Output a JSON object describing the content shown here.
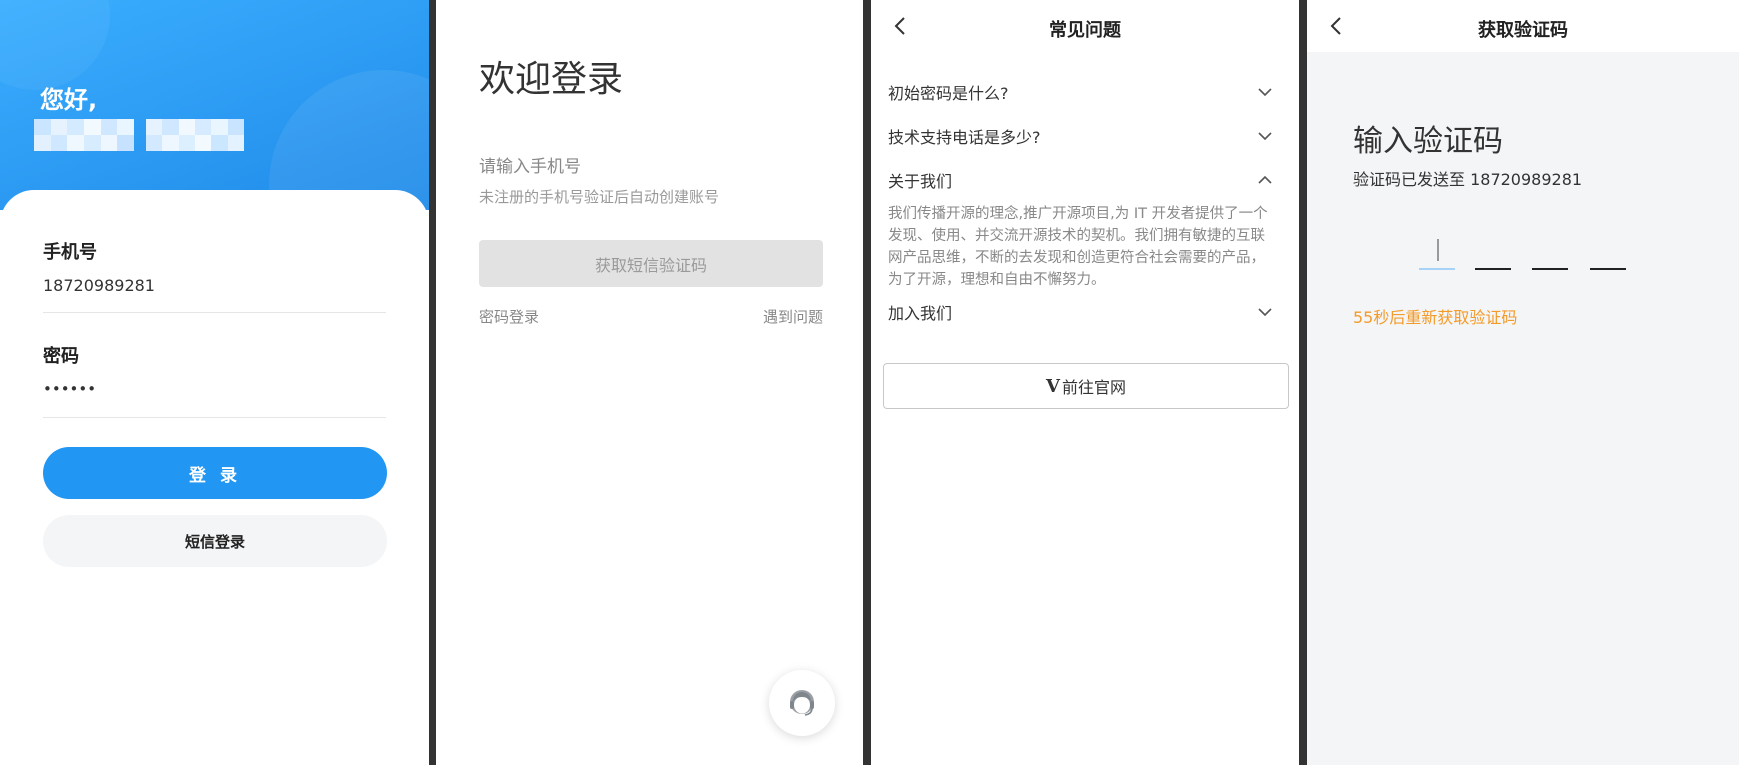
{
  "login": {
    "greeting": "您好,",
    "phone_label": "手机号",
    "phone_value": "18720989281",
    "password_label": "密码",
    "password_value": "••••••",
    "login_button": "登 录",
    "sms_login_button": "短信登录",
    "colors": {
      "primary": "#2196f3",
      "header_gradient_start": "#3aaeff",
      "header_gradient_end": "#1e8ae8"
    }
  },
  "sms_login": {
    "title": "欢迎登录",
    "phone_placeholder": "请输入手机号",
    "hint": "未注册的手机号验证后自动创建账号",
    "get_code_button": "获取短信验证码",
    "password_login_link": "密码登录",
    "problem_link": "遇到问题",
    "support_icon": "customer-service-icon"
  },
  "faq": {
    "title": "常见问题",
    "back_icon": "chevron-left-icon",
    "items": [
      {
        "question": "初始密码是什么?",
        "expanded": false
      },
      {
        "question": "技术支持电话是多少?",
        "expanded": false
      },
      {
        "question": "关于我们",
        "expanded": true,
        "answer": "我们传播开源的理念,推广开源项目,为 IT 开发者提供了一个发现、使用、并交流开源技术的契机。我们拥有敏捷的互联网产品思维，不断的去发现和创造更符合社会需要的产品，为了开源，理想和自由不懈努力。"
      },
      {
        "question": "加入我们",
        "expanded": false
      }
    ],
    "website_logo": "V",
    "website_button": "前往官网"
  },
  "verify": {
    "title": "获取验证码",
    "heading": "输入验证码",
    "sent_text": "验证码已发送至 18720989281",
    "code_length": 4,
    "resend_text": "55秒后重新获取验证码",
    "colors": {
      "resend": "#f39b2a",
      "active_slot": "#a9d2f8"
    }
  }
}
